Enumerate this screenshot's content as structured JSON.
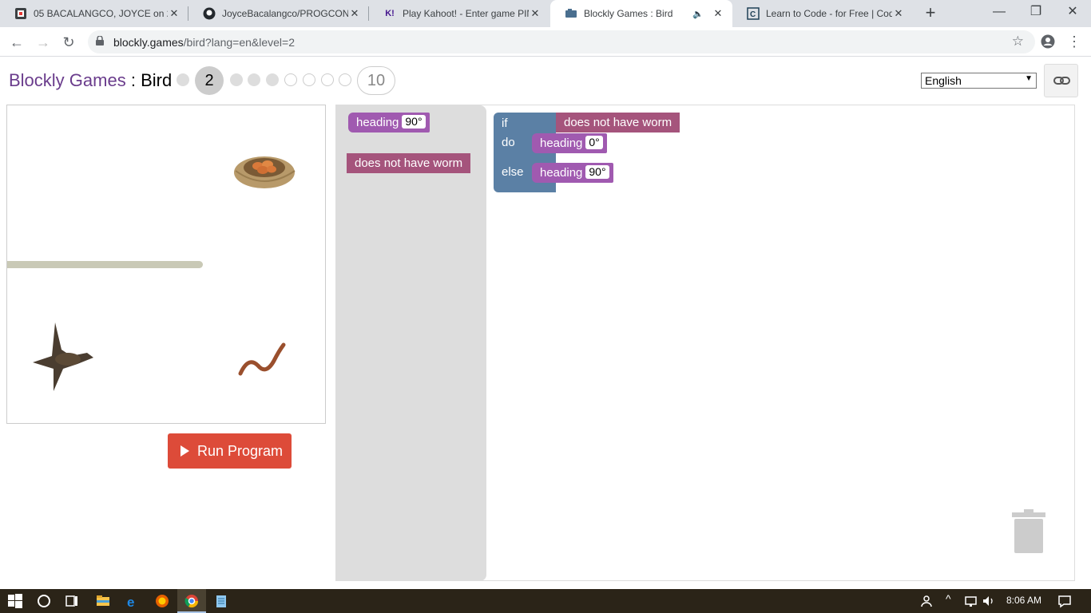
{
  "browser": {
    "tabs": [
      {
        "title": "05 BACALANGCO, JOYCE on 2020",
        "icon": "tasks-icon"
      },
      {
        "title": "JoyceBacalangco/PROGCON: M",
        "icon": "github-icon"
      },
      {
        "title": "Play Kahoot! - Enter game PIN",
        "icon": "kahoot-icon",
        "icon_text": "K!"
      },
      {
        "title": "Blockly Games : Bird",
        "icon": "blockly-icon",
        "active": true
      },
      {
        "title": "Learn to Code - for Free | Code",
        "icon": "codecademy-icon"
      }
    ],
    "new_tab": "+",
    "url_host": "blockly.games",
    "url_path": "/bird?lang=en&level=2"
  },
  "page": {
    "title_link": "Blockly Games",
    "title_sep": " : ",
    "title_game": "Bird",
    "current_level": "2",
    "last_level": "10",
    "language": "English"
  },
  "run_button": "Run Program",
  "flyout": {
    "heading_label": "heading",
    "heading_value": "90°",
    "condition_label": "does not have worm"
  },
  "workspace": {
    "if_label": "if",
    "do_label": "do",
    "else_label": "else",
    "condition_label": "does not have worm",
    "do_heading_label": "heading",
    "do_heading_value": "0°",
    "else_heading_label": "heading",
    "else_heading_value": "90°"
  },
  "taskbar": {
    "time": "8:06 AM"
  },
  "colors": {
    "title_link": "#6a3c8c",
    "heading_block": "#a05ab0",
    "condition_block": "#a5547c",
    "logic_block": "#5b80a5",
    "run_button": "#dd4b39"
  }
}
